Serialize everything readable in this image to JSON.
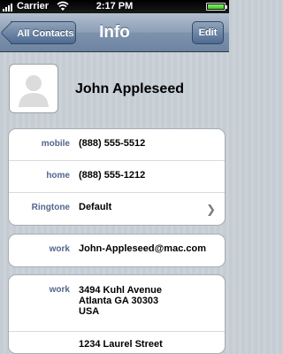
{
  "status_bar": {
    "carrier": "Carrier",
    "time": "2:17 PM",
    "signal_icon": "signal-bars-icon",
    "wifi_icon": "wifi-icon",
    "battery_icon": "battery-icon"
  },
  "nav": {
    "back_label": "All Contacts",
    "title": "Info",
    "edit_label": "Edit"
  },
  "contact": {
    "name": "John Appleseed",
    "avatar_icon": "person-silhouette-icon"
  },
  "phones": [
    {
      "label": "mobile",
      "value": "(888) 555-5512"
    },
    {
      "label": "home",
      "value": "(888) 555-1212"
    }
  ],
  "ringtone": {
    "label": "Ringtone",
    "value": "Default"
  },
  "email": {
    "label": "work",
    "value": "John-Appleseed@mac.com"
  },
  "address": {
    "label": "work",
    "line1": "3494 Kuhl Avenue",
    "line2": "Atlanta GA 30303",
    "line3": "USA"
  },
  "address2_partial": {
    "line1": "1234 Laurel Street"
  },
  "colors": {
    "nav_bar": "#7d93ad",
    "label_blue": "#52668a",
    "background": "#c5ccd4"
  }
}
